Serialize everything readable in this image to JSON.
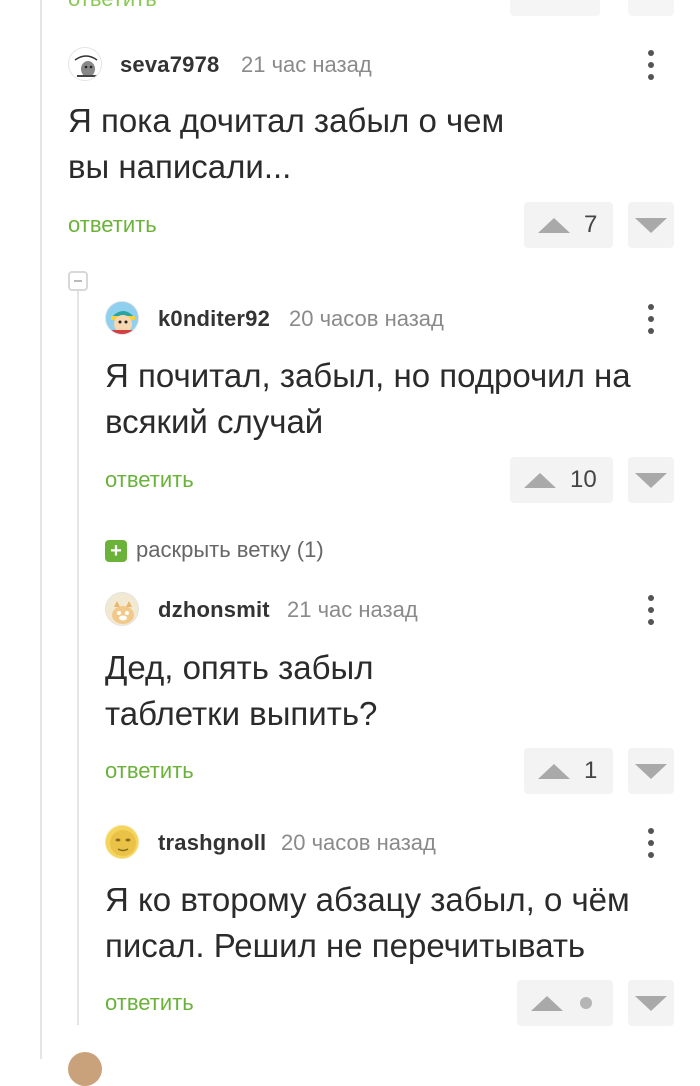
{
  "previous_comment": {
    "reply_label": "ответить"
  },
  "comments": [
    {
      "username": "seva7978",
      "time": "21 час назад",
      "text": "Я пока дочитал забыл о чем\nвы написали...",
      "reply_label": "ответить",
      "rating": "7",
      "avatar_icon": "meme-avatar-icon"
    },
    {
      "username": "k0nditer92",
      "time": "20 часов назад",
      "text": "Я почитал, забыл, но подрочил на\nвсякий случай",
      "reply_label": "ответить",
      "rating": "10",
      "avatar_icon": "cartman-avatar-icon"
    },
    {
      "username": "dzhonsmit",
      "time": "21 час назад",
      "text": "Дед, опять забыл\nтаблетки выпить?",
      "reply_label": "ответить",
      "rating": "1",
      "avatar_icon": "cat-avatar-icon"
    },
    {
      "username": "trashgnoll",
      "time": "20 часов назад",
      "text": "Я ко второму абзацу забыл, о чём\nписал. Решил не перечитывать",
      "reply_label": "ответить",
      "rating": "",
      "avatar_icon": "moon-face-avatar-icon"
    }
  ],
  "expand_thread": {
    "icon": "+",
    "label": "раскрыть ветку (1)"
  },
  "colors": {
    "accent_green": "#6bb23a",
    "muted_text": "#8a8a8a",
    "vote_bg": "#f3f3f3"
  }
}
